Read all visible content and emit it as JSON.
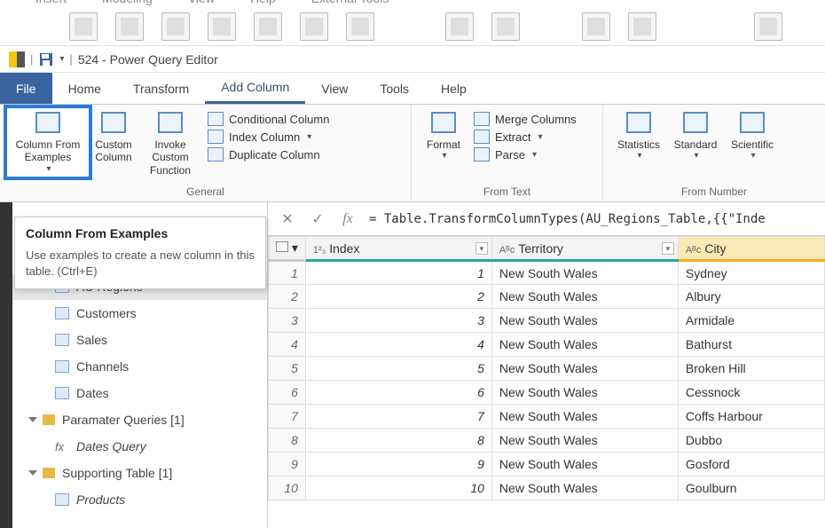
{
  "parent_menu": [
    "Insert",
    "Modeling",
    "View",
    "Help",
    "External Tools"
  ],
  "window_title": "524 - Power Query Editor",
  "tabs": {
    "file": "File",
    "items": [
      "Home",
      "Transform",
      "Add Column",
      "View",
      "Tools",
      "Help"
    ],
    "active": "Add Column"
  },
  "ribbon": {
    "general": {
      "column_from_examples": "Column From Examples",
      "custom_column": "Custom Column",
      "invoke_custom_function": "Invoke Custom Function",
      "conditional_column": "Conditional Column",
      "index_column": "Index Column",
      "duplicate_column": "Duplicate Column",
      "label": "General"
    },
    "from_text": {
      "format": "Format",
      "merge_columns": "Merge Columns",
      "extract": "Extract",
      "parse": "Parse",
      "label": "From Text"
    },
    "from_number": {
      "statistics": "Statistics",
      "standard": "Standard",
      "scientific": "Scientific",
      "label": "From Number"
    }
  },
  "tooltip": {
    "title": "Column From Examples",
    "body": "Use examples to create a new column in this table. (Ctrl+E)"
  },
  "queries": {
    "items": [
      {
        "name": "AU Regions",
        "type": "table",
        "selected": true
      },
      {
        "name": "Customers",
        "type": "table"
      },
      {
        "name": "Sales",
        "type": "table"
      },
      {
        "name": "Channels",
        "type": "table"
      },
      {
        "name": "Dates",
        "type": "table"
      }
    ],
    "folder1": {
      "label": "Paramater Queries [1]",
      "item": "Dates Query"
    },
    "folder2": {
      "label": "Supporting Table [1]",
      "item": "Products"
    }
  },
  "formula_bar": {
    "text": "= Table.TransformColumnTypes(AU_Regions_Table,{{\"Inde"
  },
  "grid": {
    "columns": [
      {
        "type": "1²₃",
        "name": "Index"
      },
      {
        "type": "Aᴮc",
        "name": "Territory"
      },
      {
        "type": "Aᴮc",
        "name": "City",
        "selected": true
      }
    ],
    "rows": [
      {
        "n": "1",
        "index": "1",
        "territory": "New South Wales",
        "city": "Sydney"
      },
      {
        "n": "2",
        "index": "2",
        "territory": "New South Wales",
        "city": "Albury"
      },
      {
        "n": "3",
        "index": "3",
        "territory": "New South Wales",
        "city": "Armidale"
      },
      {
        "n": "4",
        "index": "4",
        "territory": "New South Wales",
        "city": "Bathurst"
      },
      {
        "n": "5",
        "index": "5",
        "territory": "New South Wales",
        "city": "Broken Hill"
      },
      {
        "n": "6",
        "index": "6",
        "territory": "New South Wales",
        "city": "Cessnock"
      },
      {
        "n": "7",
        "index": "7",
        "territory": "New South Wales",
        "city": "Coffs Harbour"
      },
      {
        "n": "8",
        "index": "8",
        "territory": "New South Wales",
        "city": "Dubbo"
      },
      {
        "n": "9",
        "index": "9",
        "territory": "New South Wales",
        "city": "Gosford"
      },
      {
        "n": "10",
        "index": "10",
        "territory": "New South Wales",
        "city": "Goulburn"
      }
    ]
  }
}
